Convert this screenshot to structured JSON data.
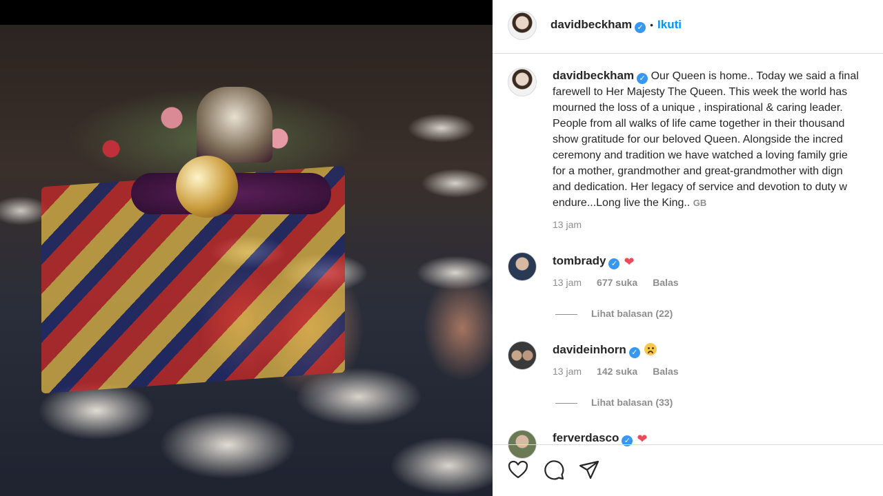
{
  "post": {
    "author": "davidbeckham",
    "follow_separator": "•",
    "follow_label": "Ikuti",
    "caption_lines": [
      "Our Queen is home.. Today we said a final",
      "farewell to Her Majesty The Queen. This week the world has",
      "mourned the loss of a unique , inspirational & caring leader.",
      "People from all walks of life came together in their thousand",
      "show gratitude for our beloved Queen. Alongside the incred",
      "ceremony and tradition we have watched a loving family grie",
      "for a mother, grandmother and great-grandmother with dign",
      "and dedication. Her legacy of service and devotion to duty w",
      "endure...Long live the King.."
    ],
    "caption_signature": "GB",
    "time": "13 jam"
  },
  "comments": [
    {
      "username": "tombrady",
      "emoji": "heart",
      "time": "13 jam",
      "likes": "677 suka",
      "reply_label": "Balas",
      "view_replies": "Lihat balasan (22)"
    },
    {
      "username": "davideinhorn",
      "emoji": "sad-face",
      "time": "13 jam",
      "likes": "142 suka",
      "reply_label": "Balas",
      "view_replies": "Lihat balasan (33)"
    },
    {
      "username": "ferverdasco",
      "emoji": "heart"
    }
  ],
  "colors": {
    "link_blue": "#0095f6",
    "verified_blue": "#3897f0",
    "heart_red": "#ed4956",
    "muted_text": "#8e8e8e"
  },
  "icons": {
    "verified": "verified-badge-icon",
    "like": "heart-outline-icon",
    "comment": "comment-bubble-icon",
    "share": "paper-plane-icon"
  }
}
